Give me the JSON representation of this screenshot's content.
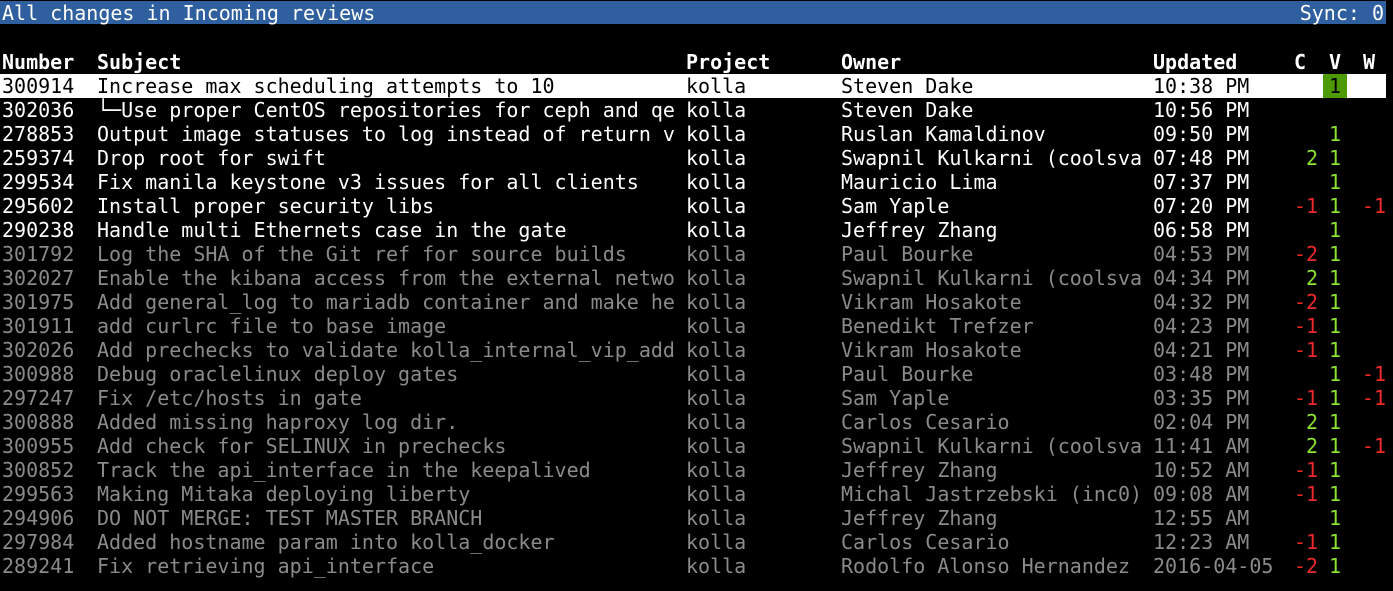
{
  "titlebar": {
    "title": "All changes in Incoming reviews",
    "sync": "Sync: 0"
  },
  "columns": {
    "number": "Number",
    "subject": "Subject",
    "project": "Project",
    "owner": "Owner",
    "updated": "Updated",
    "c": "C",
    "v": "V",
    "w": "W"
  },
  "rows": [
    {
      "number": "300914",
      "subject": "Increase max scheduling attempts to 10",
      "project": "kolla",
      "owner": "Steven Dake",
      "updated": "10:38 PM",
      "c": "",
      "v": "1",
      "w": "",
      "style": "selected"
    },
    {
      "number": "302036",
      "subject": "└─Use proper CentOS repositories for ceph and qe",
      "project": "kolla",
      "owner": "Steven Dake",
      "updated": "10:56 PM",
      "c": "",
      "v": "",
      "w": "",
      "style": "bright"
    },
    {
      "number": "278853",
      "subject": "Output image statuses to log instead of return v",
      "project": "kolla",
      "owner": "Ruslan Kamaldinov",
      "updated": "09:50 PM",
      "c": "",
      "v": "1",
      "w": "",
      "style": "bright"
    },
    {
      "number": "259374",
      "subject": "Drop root for swift",
      "project": "kolla",
      "owner": "Swapnil Kulkarni (coolsva",
      "updated": "07:48 PM",
      "c": "2",
      "v": "1",
      "w": "",
      "style": "bright"
    },
    {
      "number": "299534",
      "subject": "Fix manila keystone v3 issues for all clients",
      "project": "kolla",
      "owner": "Mauricio Lima",
      "updated": "07:37 PM",
      "c": "",
      "v": "1",
      "w": "",
      "style": "bright"
    },
    {
      "number": "295602",
      "subject": "Install proper security libs",
      "project": "kolla",
      "owner": "Sam Yaple",
      "updated": "07:20 PM",
      "c": "-1",
      "v": "1",
      "w": "-1",
      "style": "bright"
    },
    {
      "number": "290238",
      "subject": "Handle multi Ethernets case in the gate",
      "project": "kolla",
      "owner": "Jeffrey Zhang",
      "updated": "06:58 PM",
      "c": "",
      "v": "1",
      "w": "",
      "style": "bright"
    },
    {
      "number": "301792",
      "subject": "Log the SHA of the Git ref for source builds",
      "project": "kolla",
      "owner": "Paul Bourke",
      "updated": "04:53 PM",
      "c": "-2",
      "v": "1",
      "w": "",
      "style": "dim"
    },
    {
      "number": "302027",
      "subject": "Enable the kibana access from the external netwo",
      "project": "kolla",
      "owner": "Swapnil Kulkarni (coolsva",
      "updated": "04:34 PM",
      "c": "2",
      "v": "1",
      "w": "",
      "style": "dim"
    },
    {
      "number": "301975",
      "subject": "Add general_log to mariadb container and make he",
      "project": "kolla",
      "owner": "Vikram Hosakote",
      "updated": "04:32 PM",
      "c": "-2",
      "v": "1",
      "w": "",
      "style": "dim"
    },
    {
      "number": "301911",
      "subject": "add curlrc file to base image",
      "project": "kolla",
      "owner": "Benedikt Trefzer",
      "updated": "04:23 PM",
      "c": "-1",
      "v": "1",
      "w": "",
      "style": "dim"
    },
    {
      "number": "302026",
      "subject": "Add prechecks to validate kolla_internal_vip_add",
      "project": "kolla",
      "owner": "Vikram Hosakote",
      "updated": "04:21 PM",
      "c": "-1",
      "v": "1",
      "w": "",
      "style": "dim"
    },
    {
      "number": "300988",
      "subject": "Debug oraclelinux deploy gates",
      "project": "kolla",
      "owner": "Paul Bourke",
      "updated": "03:48 PM",
      "c": "",
      "v": "1",
      "w": "-1",
      "style": "dim"
    },
    {
      "number": "297247",
      "subject": "Fix /etc/hosts in gate",
      "project": "kolla",
      "owner": "Sam Yaple",
      "updated": "03:35 PM",
      "c": "-1",
      "v": "1",
      "w": "-1",
      "style": "dim"
    },
    {
      "number": "300888",
      "subject": "Added missing haproxy log dir.",
      "project": "kolla",
      "owner": "Carlos Cesario",
      "updated": "02:04 PM",
      "c": "2",
      "v": "1",
      "w": "",
      "style": "dim"
    },
    {
      "number": "300955",
      "subject": "Add check for SELINUX in prechecks",
      "project": "kolla",
      "owner": "Swapnil Kulkarni (coolsva",
      "updated": "11:41 AM",
      "c": "2",
      "v": "1",
      "w": "-1",
      "style": "dim"
    },
    {
      "number": "300852",
      "subject": "Track the api_interface in the keepalived",
      "project": "kolla",
      "owner": "Jeffrey Zhang",
      "updated": "10:52 AM",
      "c": "-1",
      "v": "1",
      "w": "",
      "style": "dim"
    },
    {
      "number": "299563",
      "subject": "Making Mitaka deploying liberty",
      "project": "kolla",
      "owner": "Michal Jastrzebski (inc0)",
      "updated": "09:08 AM",
      "c": "-1",
      "v": "1",
      "w": "",
      "style": "dim"
    },
    {
      "number": "294906",
      "subject": "DO NOT MERGE: TEST MASTER BRANCH",
      "project": "kolla",
      "owner": "Jeffrey Zhang",
      "updated": "12:55 AM",
      "c": "",
      "v": "1",
      "w": "",
      "style": "dim"
    },
    {
      "number": "297984",
      "subject": "Added hostname param into kolla_docker",
      "project": "kolla",
      "owner": "Carlos Cesario",
      "updated": "12:23 AM",
      "c": "-1",
      "v": "1",
      "w": "",
      "style": "dim"
    },
    {
      "number": "289241",
      "subject": "Fix retrieving api_interface",
      "project": "kolla",
      "owner": "Rodolfo Alonso Hernandez",
      "updated": "2016-04-05",
      "c": "-2",
      "v": "1",
      "w": "",
      "style": "dim"
    }
  ],
  "colors": {
    "titlebar_bg": "#2f5f9f",
    "selected_bg": "#ffffff",
    "vote_box": "#4e9a06",
    "positive": "#8ae234",
    "negative": "#ef2929",
    "dim_text": "#8a8a8a"
  }
}
